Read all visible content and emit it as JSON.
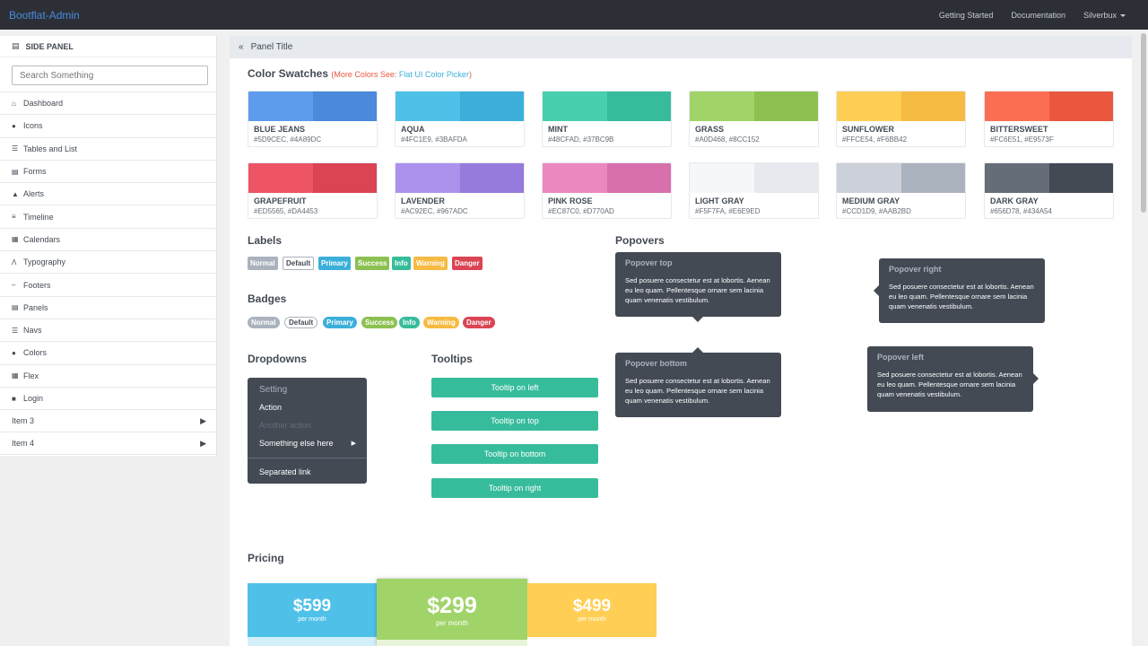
{
  "topbar": {
    "brand": "Bootflat-Admin",
    "nav": [
      "Getting Started",
      "Documentation",
      "Silverbux"
    ]
  },
  "sidebar": {
    "title": "SIDE PANEL",
    "search_placeholder": "Search Something",
    "items": [
      {
        "label": "Dashboard",
        "icon": "home-icon"
      },
      {
        "label": "Icons",
        "icon": "circle-icon"
      },
      {
        "label": "Tables and List",
        "icon": "list-icon"
      },
      {
        "label": "Forms",
        "icon": "form-icon"
      },
      {
        "label": "Alerts",
        "icon": "bell-icon"
      },
      {
        "label": "Timeline",
        "icon": "timeline-icon"
      },
      {
        "label": "Calendars",
        "icon": "calendar-icon"
      },
      {
        "label": "Typography",
        "icon": "typography-icon"
      },
      {
        "label": "Footers",
        "icon": "minus-icon"
      },
      {
        "label": "Panels",
        "icon": "panel-icon"
      },
      {
        "label": "Navs",
        "icon": "list-icon"
      },
      {
        "label": "Colors",
        "icon": "drop-icon"
      },
      {
        "label": "Flex",
        "icon": "grid-icon"
      },
      {
        "label": "Login",
        "icon": "lock-icon"
      },
      {
        "label": "Item 3",
        "icon": "",
        "arrow": true
      },
      {
        "label": "Item 4",
        "icon": "",
        "arrow": true
      }
    ]
  },
  "panel": {
    "title": "Panel Title"
  },
  "swatches": {
    "title": "Color Swatches",
    "more_label": "(More Colors See:",
    "more_link": "Flat UI Color Picker",
    "more_close": ")",
    "items": [
      {
        "name": "BLUE JEANS",
        "hex": "#5D9CEC, #4A89DC",
        "c1": "#5D9CEC",
        "c2": "#4A89DC"
      },
      {
        "name": "AQUA",
        "hex": "#4FC1E9, #3BAFDA",
        "c1": "#4FC1E9",
        "c2": "#3BAFDA"
      },
      {
        "name": "MINT",
        "hex": "#48CFAD, #37BC9B",
        "c1": "#48CFAD",
        "c2": "#37BC9B"
      },
      {
        "name": "GRASS",
        "hex": "#A0D468, #8CC152",
        "c1": "#A0D468",
        "c2": "#8CC152"
      },
      {
        "name": "SUNFLOWER",
        "hex": "#FFCE54, #F6BB42",
        "c1": "#FFCE54",
        "c2": "#F6BB42"
      },
      {
        "name": "BITTERSWEET",
        "hex": "#FC6E51, #E9573F",
        "c1": "#FC6E51",
        "c2": "#E9573F"
      },
      {
        "name": "GRAPEFRUIT",
        "hex": "#ED5565, #DA4453",
        "c1": "#ED5565",
        "c2": "#DA4453"
      },
      {
        "name": "LAVENDER",
        "hex": "#AC92EC, #967ADC",
        "c1": "#AC92EC",
        "c2": "#967ADC"
      },
      {
        "name": "PINK ROSE",
        "hex": "#EC87C0, #D770AD",
        "c1": "#EC87C0",
        "c2": "#D770AD"
      },
      {
        "name": "LIGHT GRAY",
        "hex": "#F5F7FA, #E6E9ED",
        "c1": "#F5F7FA",
        "c2": "#E6E9ED"
      },
      {
        "name": "MEDIUM GRAY",
        "hex": "#CCD1D9, #AAB2BD",
        "c1": "#CCD1D9",
        "c2": "#AAB2BD"
      },
      {
        "name": "DARK GRAY",
        "hex": "#656D78, #434A54",
        "c1": "#656D78",
        "c2": "#434A54"
      }
    ]
  },
  "labels": {
    "title": "Labels",
    "items": [
      {
        "text": "Normal",
        "color": "#AAB2BD"
      },
      {
        "text": "Default",
        "color": "#FFFFFF"
      },
      {
        "text": "Primary",
        "color": "#3BAFDA"
      },
      {
        "text": "Success",
        "color": "#8CC152"
      },
      {
        "text": "Info",
        "color": "#37BC9B"
      },
      {
        "text": "Warning",
        "color": "#F6BB42"
      },
      {
        "text": "Danger",
        "color": "#DA4453"
      }
    ]
  },
  "badges": {
    "title": "Badges",
    "items": [
      "Normal",
      "Default",
      "Primary",
      "Success",
      "Info",
      "Warning",
      "Danger"
    ]
  },
  "dropdowns": {
    "title": "Dropdowns",
    "header": "Setting",
    "items": [
      "Action",
      "Another action",
      "Something else here",
      "Separated link"
    ]
  },
  "tooltips": {
    "title": "Tooltips",
    "buttons": [
      "Tooltip on left",
      "Tooltip on top",
      "Tooltip on bottom",
      "Tooltip on right"
    ]
  },
  "popovers": {
    "title": "Popovers",
    "body": "Sed posuere consectetur est at lobortis. Aenean eu leo quam. Pellentesque ornare sem lacinia quam venenatis vestibulum.",
    "items": [
      "Popover top",
      "Popover right",
      "Popover bottom",
      "Popover left"
    ]
  },
  "pricing": {
    "title": "Pricing",
    "plans": [
      {
        "price": "$599",
        "period": "per month",
        "color": "#4FC1E9"
      },
      {
        "price": "$299",
        "period": "per month",
        "color": "#A0D468"
      },
      {
        "price": "$499",
        "period": "per month",
        "color": "#FFCE54"
      }
    ]
  }
}
